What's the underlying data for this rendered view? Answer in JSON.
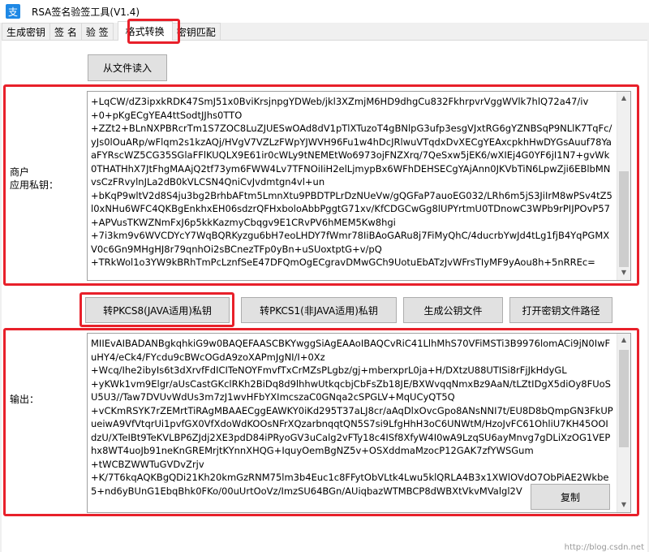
{
  "window": {
    "icon_glyph": "支",
    "title": "RSA签名验签工具(V1.4)"
  },
  "tabs": [
    {
      "label": "生成密钥"
    },
    {
      "label": "签 名"
    },
    {
      "label": "验 签"
    },
    {
      "label": "格式转换"
    },
    {
      "label": "密钥匹配"
    }
  ],
  "toolbar": {
    "read_file_label": "从文件读入"
  },
  "private_key": {
    "label_line1": "商户",
    "label_line2": "应用私钥：",
    "value": "+LqCW/dZ3ipxkRDK47SmJ51x0BviKrsjnpgYDWeb/jkl3XZmjM6HD9dhgCu832FkhrpvrVggWVlk7hlQ72a47/iv\n+0+pKgECgYEA4ttSodtJJhs0TTO\n+ZZt2+BLnNXPBRcrTm1S7ZOC8LuZJUESwOAd8dV1pTlXTuzoT4gBNlpG3ufp3esgVJxtRG6gYZNBSqP9NLlK7TqFc/yJs0lOuARp/wFlqm2s1kzAQj/HVgV7VZLzFWpYJWVH96Fu1w4hDcJRlwuVTqdxDvXECgYEAxcpkhHwDYGsAuuf78YaaFYRscWZ5CG35SGlaFFlKUQLX9E61ir0cWLy9tNEMEtWo6973ojFNZXrq/7QeSxw5jEK6/wXIEj4G0YF6jI1N7+gvWk0THATHhX7JtFhgMAAjQ2tf73ym6FWW4Lv7TFNOiIiH2elLjmypBx6WFhDEHSECgYAjAnn0JKVbTiN6LpwZji6EBlbMNvsCzFRvylnJLa2dB0kVLCSN4QniCvJvdmtgn4vl+un\n+bKqP9wltV2d8S4ju3bg2BrhbAFtm5LmnXtu9PBDTPLrDzNUeVw/gQGFaP7auoEG032/LRh6m5jS3JiIrM8wPSv4tZ5l0xNHu6WFC4QKBgEnkhxEH06sdzrQFHxboloAbbPggtG71xv/KfCDGCwGg8lUPYrtmU0TDnowC3WPb9rPIJPOvP57+APVusTKWZNmFxJ6p5kkKazmyCbqgv9E1CRvPV6hMEM5Kw8hgi\n+7i3km9v6WVCDYcY7WqBQRKyzgu6bH7eoLHDY7fWmr78IiBAoGARu8j7FiMyQhC/4ducrbYwJd4tLg1fjB4YqPGMXV0c6Gn9MHgHJ8r79qnhOi2sBCnezTFp0yBn+uSUoxtptG+v/pQ\n+TRkWol1o3YW9kBRhTmPcLznfSeE47DFQmOgECgravDMwGCh9UotuEbATzJvWFrsTIyMF9yAou8h+5nRREc="
  },
  "actions": {
    "to_pkcs8_label": "转PKCS8(JAVA适用)私钥",
    "to_pkcs1_label": "转PKCS1(非JAVA适用)私钥",
    "gen_public_label": "生成公钥文件",
    "open_path_label": "打开密钥文件路径"
  },
  "output": {
    "label": "输出：",
    "value": "MIIEvAIBADANBgkqhkiG9w0BAQEFAASCBKYwggSiAgEAAoIBAQCvRiC41LlhMhS70VFiMSTi3B9976lomACi9jN0IwFuHY4/eCk4/FYcdu9cBWcOGdA9zoXAPmJgNI/I+0Xz\n+Wcq/Ihe2ibyIs6t3dXrvfFdICITeNOYFmvfTxCrMZsPLgbz/gj+mberxprL0ja+H/DXtzU88UTISi8rFjJkHdyGL\n+yKWk1vm9Elgr/aUsCastGKclRKh2BiDq8d9lhhwUtkqcbjCbFsZb18JE/BXWvqqNmxBz9AaN/tLZtIDgX5diOy8FUoSU5U3//Taw7DVUvWdUs3m7zJ1wvHFbYXImcszaC0GNqa2cSPGLV+MqUCyQT5Q\n+vCKmRSYK7rZEMrtTiRAgMBAAECggEAWKY0iKd295T37aLJ8cr/aAqDlxOvcGpo8ANsNNI7t/EU8D8bQmpGN3FkUPueiwA9VfVtqrUi1pvfGX0VfXdoWdKOOsNFrXQzarbnqqtQN5S7si9LfgHhH3oC6UNWtM/HzoJvFC61OhliU7KH45OOIdzU/XTeIBt9TeKVLBP6ZJdj2XE3pdD84iPRyoGV3uCalg2vFTy18c4ISf8XfyW4I0wA9LzqSU6ayMnvg7gDLiXzOG1VEPhx8WT4uoJb91neKnGREMrjtKYnnXHQG+IquyOemBgNZ5v+OSXddmaMzocP12GAK7zfYWSGum\n+tWCBZWWTuGVDvZrjv\n+K/7T6kqAQKBgQDi21Kh20kmGzRNM75lm3b4Euc1c8FFytObVLtk4Lwu5klQRLA4B3x1XWlOVdO7ObPiAE2Wkbe5+nd6yBUnG1EbqBhk0FKo/00uUrtOoVz/ImzSU64BGn/AUiqbazWTMBCP8dWBXtVkvMValgl2V"
  },
  "copy_label": "复制",
  "watermark": "http://blog.csdn.net"
}
